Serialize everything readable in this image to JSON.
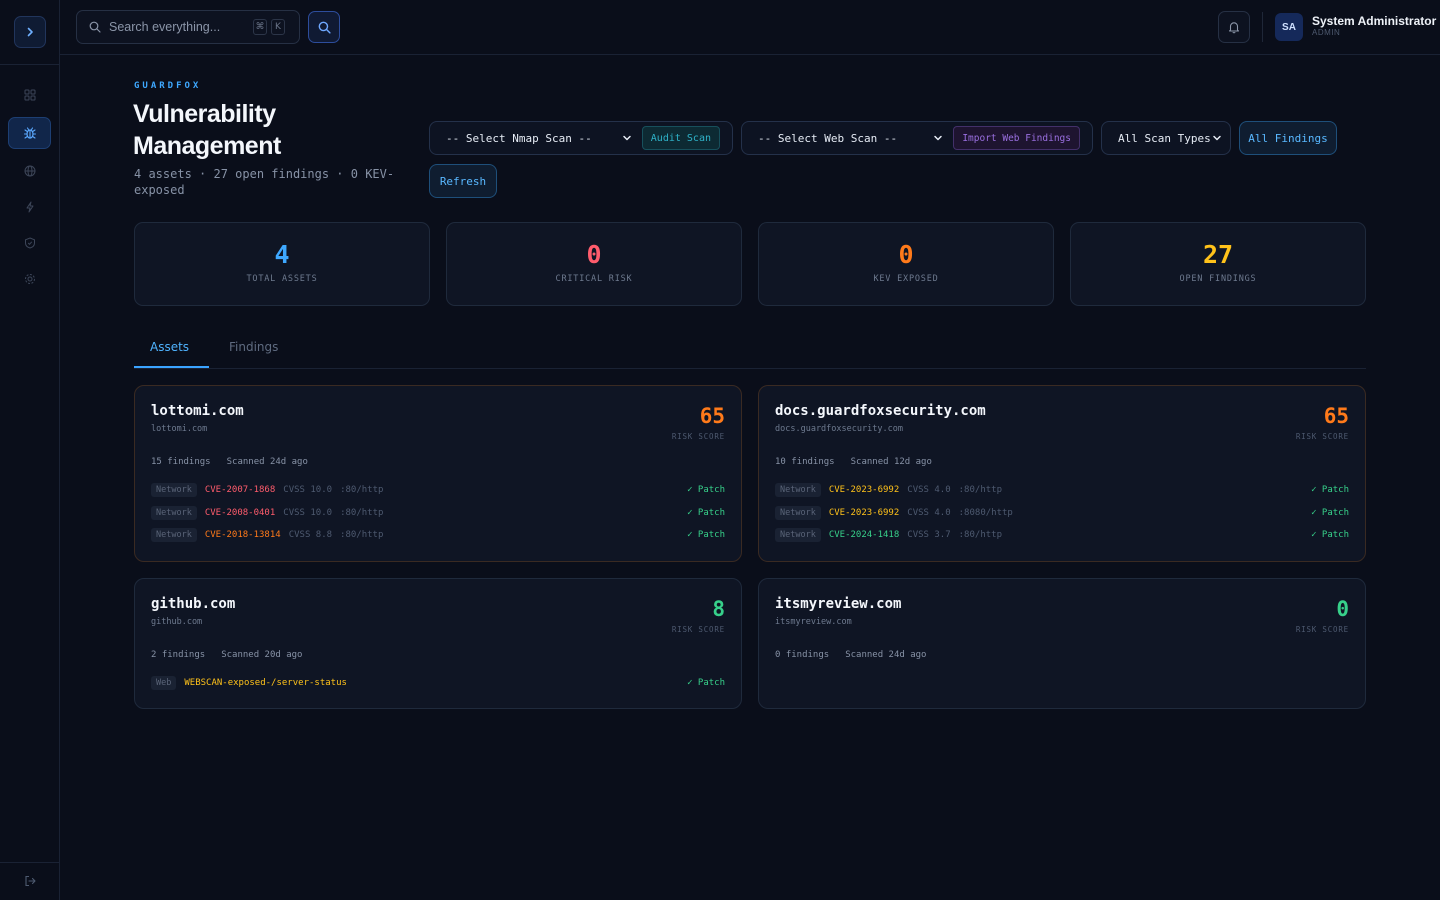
{
  "topbar": {
    "search_placeholder": "Search everything...",
    "kbd_cmd": "⌘",
    "kbd_k": "K",
    "user_initials": "SA",
    "user_name": "System Administrator",
    "user_role": "ADMIN"
  },
  "header": {
    "brand": "GUARDFOX",
    "title": "Vulnerability Management",
    "subtitle": "4 assets · 27 open findings · 0 KEV-exposed"
  },
  "controls": {
    "nmap_select": "-- Select Nmap Scan --",
    "audit_button": "Audit Scan",
    "web_select": "-- Select Web Scan --",
    "import_button": "Import Web Findings",
    "scan_types_select": "All Scan Types",
    "all_findings_button": "All Findings",
    "refresh_button": "Refresh"
  },
  "stats": [
    {
      "value": "4",
      "label": "TOTAL ASSETS",
      "color": "#3ea8ff"
    },
    {
      "value": "0",
      "label": "CRITICAL RISK",
      "color": "#ff5c6c"
    },
    {
      "value": "0",
      "label": "KEV EXPOSED",
      "color": "#ff7a1a"
    },
    {
      "value": "27",
      "label": "OPEN FINDINGS",
      "color": "#ffc21a"
    }
  ],
  "tabs": {
    "assets": "Assets",
    "findings": "Findings"
  },
  "score_label": "RISK SCORE",
  "patch_label": "✓ Patch",
  "assets": [
    {
      "name": "lottomi.com",
      "host": "lottomi.com",
      "score": "65",
      "score_color": "#ff7a1a",
      "findings_count": "15 findings",
      "scanned": "Scanned 24d ago",
      "findings": [
        {
          "type": "Network",
          "id": "CVE-2007-1868",
          "id_color": "#ff5c6c",
          "cvss": "CVSS 10.0",
          "port": ":80/http"
        },
        {
          "type": "Network",
          "id": "CVE-2008-0401",
          "id_color": "#ff5c6c",
          "cvss": "CVSS 10.0",
          "port": ":80/http"
        },
        {
          "type": "Network",
          "id": "CVE-2018-13814",
          "id_color": "#ff7a1a",
          "cvss": "CVSS 8.8",
          "port": ":80/http"
        }
      ]
    },
    {
      "name": "docs.guardfoxsecurity.com",
      "host": "docs.guardfoxsecurity.com",
      "score": "65",
      "score_color": "#ff7a1a",
      "findings_count": "10 findings",
      "scanned": "Scanned 12d ago",
      "findings": [
        {
          "type": "Network",
          "id": "CVE-2023-6992",
          "id_color": "#ffc21a",
          "cvss": "CVSS 4.0",
          "port": ":80/http"
        },
        {
          "type": "Network",
          "id": "CVE-2023-6992",
          "id_color": "#ffc21a",
          "cvss": "CVSS 4.0",
          "port": ":8080/http"
        },
        {
          "type": "Network",
          "id": "CVE-2024-1418",
          "id_color": "#37d08a",
          "cvss": "CVSS 3.7",
          "port": ":80/http"
        }
      ]
    },
    {
      "name": "github.com",
      "host": "github.com",
      "score": "8",
      "score_color": "#37d08a",
      "findings_count": "2 findings",
      "scanned": "Scanned 20d ago",
      "findings": [
        {
          "type": "Web",
          "id": "WEBSCAN-exposed-/server-status",
          "id_color": "#ffc21a",
          "cvss": "",
          "port": ""
        }
      ]
    },
    {
      "name": "itsmyreview.com",
      "host": "itsmyreview.com",
      "score": "0",
      "score_color": "#37d08a",
      "findings_count": "0 findings",
      "scanned": "Scanned 24d ago",
      "findings": []
    }
  ]
}
